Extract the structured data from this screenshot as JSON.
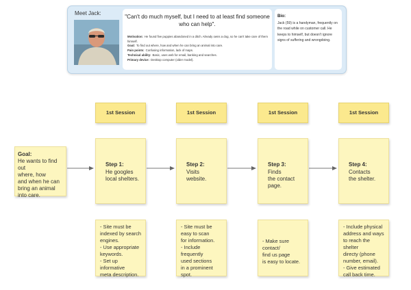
{
  "persona": {
    "meet_label": "Meet Jack:",
    "quote": "\"Can't do much myself, but I need to at least find someone who can help\".",
    "specs": [
      {
        "label": "Motivation:",
        "text": "He found five puppies abandoned in a ditch. Already owns a dog, so he can't take care of them himself."
      },
      {
        "label": "Goal:",
        "text": "To find out where, how and when he can bring an animal into care."
      },
      {
        "label": "Pain points:",
        "text": "Confusing information, lack of maps."
      },
      {
        "label": "Technical ability:",
        "text": "Basic, uses web for email, banking and searches."
      },
      {
        "label": "Primary device:",
        "text": "Desktop computer (older model)."
      }
    ],
    "bio_title": "Bio:",
    "bio_text": "Jack (59) is a handyman, frequently on the road while on customer call. He keeps to himself, but doesn't ignore signs of suffering and wrongdoing."
  },
  "goal": {
    "title": "Goal:",
    "lines": [
      "He wants to find out",
      "where, how",
      "and when he can",
      "bring an animal",
      "into care."
    ]
  },
  "steps": [
    {
      "session": "1st Session",
      "title": "Step 1:",
      "lines": [
        "He googles",
        "local shelters."
      ],
      "requirements": [
        "- Site must be",
        "indexed by search",
        "engines.",
        "- Use appropriate",
        "keywords.",
        "- Set up informative",
        "meta description."
      ]
    },
    {
      "session": "1st Session",
      "title": "Step 2:",
      "lines": [
        "Visits website."
      ],
      "requirements": [
        "- Site must be",
        "easy to scan",
        "for information.",
        "- Include frequently",
        "used sections",
        "in a prominent",
        "spot."
      ]
    },
    {
      "session": "1st Session",
      "title": "Step 3:",
      "lines": [
        "Finds",
        "the contact",
        "page."
      ],
      "requirements": [
        "- Make sure contact/",
        "find us page",
        "is easy to locate."
      ]
    },
    {
      "session": "1st Session",
      "title": "Step 4:",
      "lines": [
        "Contacts",
        "the shelter."
      ],
      "requirements": [
        "- Include physical",
        "address and ways",
        "to reach the shelter",
        "directy (phone",
        "number, email).",
        "- Give estimated",
        "call back time."
      ]
    }
  ]
}
